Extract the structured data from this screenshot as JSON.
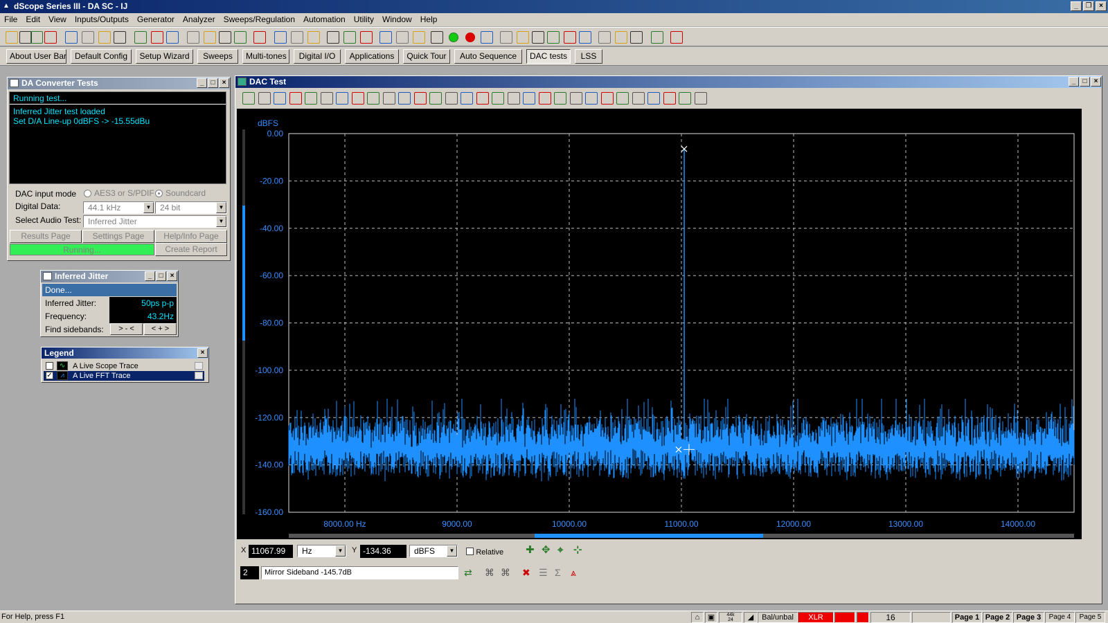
{
  "app": {
    "title": "dScope Series III - DA SC - IJ",
    "menu": [
      "File",
      "Edit",
      "View",
      "Inputs/Outputs",
      "Generator",
      "Analyzer",
      "Sweeps/Regulation",
      "Automation",
      "Utility",
      "Window",
      "Help"
    ]
  },
  "user_bar": {
    "buttons": [
      "About User Bar",
      "Default Config",
      "Setup Wizard",
      "Sweeps",
      "Multi-tones",
      "Digital I/O",
      "Applications",
      "Quick Tour",
      "Auto Sequence",
      "DAC tests",
      "LSS"
    ],
    "active": "DAC tests"
  },
  "da_panel": {
    "title": "DA Converter Tests",
    "running": "Running test...",
    "log": [
      "Inferred Jitter test loaded",
      "Set D/A Line-up 0dBFS -> -15.55dBu"
    ],
    "dac_input_mode_label": "DAC input mode",
    "radio_aes": "AES3 or S/PDIF",
    "radio_soundcard": "Soundcard",
    "digital_data_label": "Digital Data:",
    "sample_rate": "44.1 kHz",
    "bit_depth": "24 bit",
    "select_test_label": "Select Audio Test:",
    "selected_test": "Inferred Jitter",
    "results_btn": "Results Page",
    "settings_btn": "Settings Page",
    "help_btn": "Help/Info Page",
    "running_btn": "Running...",
    "report_btn": "Create Report"
  },
  "ij_panel": {
    "title": "Inferred Jitter",
    "status": "Done...",
    "jitter_label": "Inferred Jitter:",
    "jitter_value": "50ps p-p",
    "freq_label": "Frequency:",
    "freq_value": "43.2Hz",
    "sidebands_label": "Find sidebands:",
    "btn_in": "> - <",
    "btn_out": "< + >"
  },
  "legend": {
    "title": "Legend",
    "items": [
      {
        "label": "A Live Scope Trace",
        "checked": false,
        "selected": false
      },
      {
        "label": "A Live FFT Trace",
        "checked": true,
        "selected": true
      }
    ]
  },
  "dac_test": {
    "title": "DAC Test",
    "x_readout": "11067.99",
    "x_unit": "Hz",
    "y_readout": "-134.36",
    "y_unit": "dBFS",
    "relative_label": "Relative",
    "marker_index": "2",
    "marker_text": "Mirror Sideband -145.7dB"
  },
  "chart_data": {
    "type": "line",
    "ylabel": "dBFS",
    "xunit": "Hz",
    "xlim": [
      7500,
      14500
    ],
    "ylim": [
      -160,
      0
    ],
    "x_ticks": [
      8000,
      9000,
      10000,
      11000,
      12000,
      13000,
      14000
    ],
    "x_tick_labels": [
      "8000.00 Hz",
      "9000.00",
      "10000.00",
      "11000.00",
      "12000.00",
      "13000.00",
      "14000.00"
    ],
    "y_ticks": [
      0,
      -20,
      -40,
      -60,
      -80,
      -100,
      -120,
      -140,
      -160
    ],
    "y_tick_labels": [
      "0.00",
      "-20.00",
      "-40.00",
      "-60.00",
      "-80.00",
      "-100.00",
      "-120.00",
      "-140.00",
      "-160.00"
    ],
    "grid": true,
    "series": [
      {
        "peak_x": 11025,
        "peak_y": -6.5,
        "noise_floor": -134,
        "color": "#1e90ff"
      }
    ],
    "markers": [
      {
        "x": 11025,
        "y": -6.5
      },
      {
        "x": 10975,
        "y": -133.5
      }
    ]
  },
  "status_bar": {
    "help": "For Help, press F1",
    "sr_top": "44k",
    "sr_bottom": "24",
    "mode": "Bal/unbal",
    "conn": "XLR",
    "count": "16",
    "pages": [
      "Page 1",
      "Page 2",
      "Page 3",
      "Page 4",
      "Page 5"
    ]
  },
  "colors": {
    "trace": "#1e90ff",
    "text_cyan": "#00e5ff",
    "grid": "#bbbbbb",
    "axis_text": "#3a8dff"
  }
}
